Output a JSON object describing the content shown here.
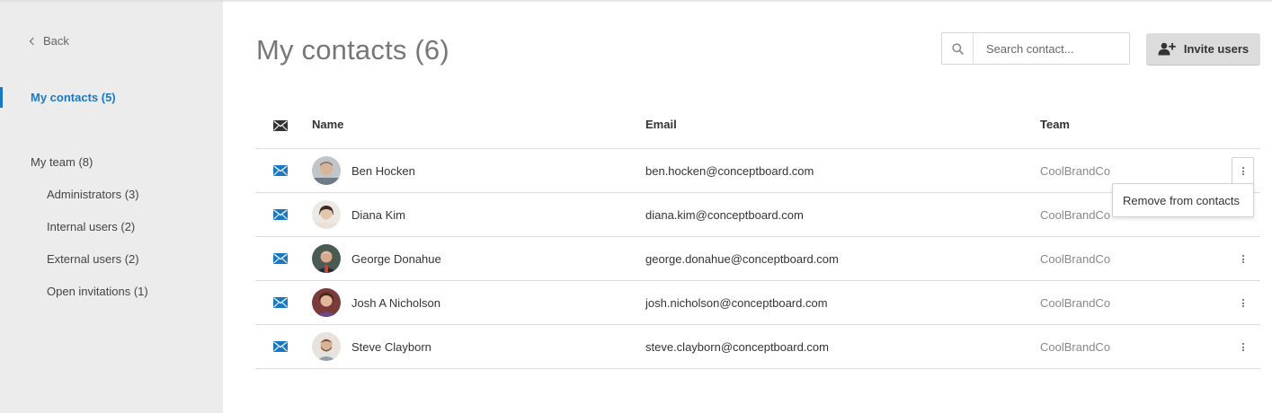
{
  "sidebar": {
    "back_label": "Back",
    "items": [
      {
        "label": "My contacts (5)",
        "active": true
      },
      {
        "label": "My team (8)"
      },
      {
        "label": "Administrators (3)"
      },
      {
        "label": "Internal users (2)"
      },
      {
        "label": "External users (2)"
      },
      {
        "label": "Open invitations (1)"
      }
    ]
  },
  "header": {
    "title": "My contacts (6)",
    "search_placeholder": "Search contact...",
    "invite_label": "Invite users"
  },
  "table": {
    "columns": [
      "Name",
      "Email",
      "Team"
    ],
    "rows": [
      {
        "name": "Ben Hocken",
        "email": "ben.hocken@conceptboard.com",
        "team": "CoolBrandCo"
      },
      {
        "name": "Diana Kim",
        "email": "diana.kim@conceptboard.com",
        "team": "CoolBrandCo"
      },
      {
        "name": "George Donahue",
        "email": "george.donahue@conceptboard.com",
        "team": "CoolBrandCo"
      },
      {
        "name": "Josh A Nicholson",
        "email": "josh.nicholson@conceptboard.com",
        "team": "CoolBrandCo"
      },
      {
        "name": "Steve Clayborn",
        "email": "steve.clayborn@conceptboard.com",
        "team": "CoolBrandCo"
      }
    ]
  },
  "context_menu": {
    "remove_label": "Remove from contacts"
  },
  "colors": {
    "accent": "#1a78c2",
    "sidebar_bg": "#ececec",
    "title_gray": "#777777",
    "team_gray": "#888888"
  }
}
